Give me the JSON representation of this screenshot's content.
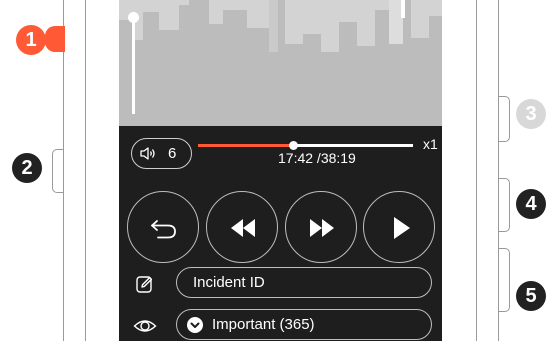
{
  "colors": {
    "accent": "#ff5a35",
    "callout_active": "#222222",
    "callout_inactive": "#d8d8d8",
    "screen_bg": "#1e1e1e",
    "video_bg": "#d3d3d3"
  },
  "callouts": [
    {
      "number": "1",
      "state": "highlighted"
    },
    {
      "number": "2",
      "state": "active"
    },
    {
      "number": "3",
      "state": "inactive"
    },
    {
      "number": "4",
      "state": "active"
    },
    {
      "number": "5",
      "state": "active"
    }
  ],
  "player": {
    "volume": {
      "icon": "speaker-icon",
      "value": "6"
    },
    "progress": {
      "fraction": 0.44
    },
    "speed": "x1",
    "time": "17:42 /38:19"
  },
  "controls": [
    {
      "name": "back-button",
      "icon": "back-arrow-icon"
    },
    {
      "name": "rewind-button",
      "icon": "rewind-icon"
    },
    {
      "name": "fast-forward-button",
      "icon": "fast-forward-icon"
    },
    {
      "name": "play-button",
      "icon": "play-icon"
    }
  ],
  "fields": {
    "incident": {
      "icon": "edit-icon",
      "text": "Incident ID"
    },
    "tag": {
      "icon": "eye-icon",
      "chevron": "chevron-down-icon",
      "text": "Important (365)"
    }
  }
}
